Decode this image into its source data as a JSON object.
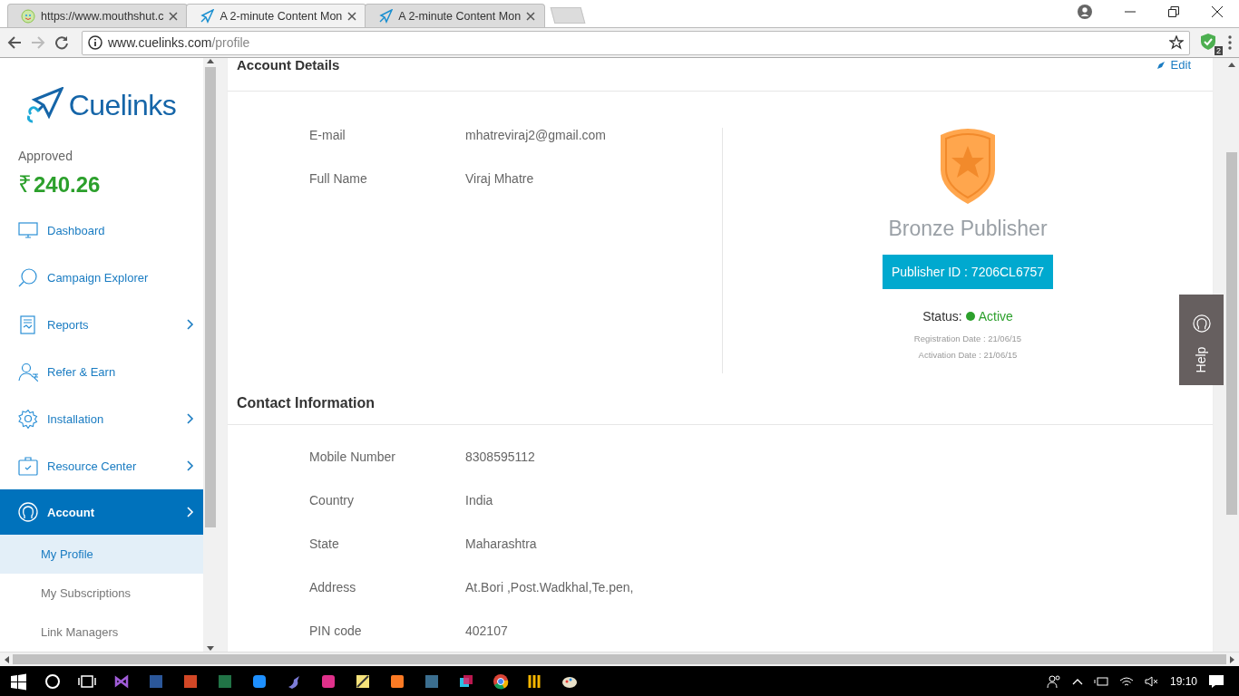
{
  "browser": {
    "tabs": [
      {
        "title": "https://www.mouthshut.c",
        "selected": false
      },
      {
        "title": "A 2-minute Content Mon",
        "selected": true
      },
      {
        "title": "A 2-minute Content Mon",
        "selected": false
      }
    ],
    "address": {
      "domain": "www.cuelinks.com",
      "path": "/profile"
    },
    "extension_badge": "2"
  },
  "sidebar": {
    "logo": "Cuelinks",
    "approved_label": "Approved",
    "currency": "₹",
    "amount": "240.26",
    "items": [
      {
        "label": "Dashboard",
        "expandable": false,
        "selected": false
      },
      {
        "label": "Campaign Explorer",
        "expandable": false,
        "selected": false
      },
      {
        "label": "Reports",
        "expandable": true,
        "selected": false
      },
      {
        "label": "Refer & Earn",
        "expandable": false,
        "selected": false
      },
      {
        "label": "Installation",
        "expandable": true,
        "selected": false
      },
      {
        "label": "Resource Center",
        "expandable": true,
        "selected": false
      },
      {
        "label": "Account",
        "expandable": true,
        "selected": true
      }
    ],
    "subitems": [
      {
        "label": "My Profile",
        "selected": true
      },
      {
        "label": "My Subscriptions",
        "selected": false
      },
      {
        "label": "Link Managers",
        "selected": false
      }
    ]
  },
  "account_details": {
    "title": "Account Details",
    "edit": "Edit",
    "fields": [
      {
        "label": "E-mail",
        "value": "mhatreviraj2@gmail.com"
      },
      {
        "label": "Full Name",
        "value": "Viraj Mhatre"
      }
    ]
  },
  "publisher": {
    "level": "Bronze Publisher",
    "publisher_id": "Publisher ID : 7206CL6757",
    "status_label": "Status:",
    "status": "Active",
    "registration": "Registration Date : 21/06/15",
    "activation": "Activation Date : 21/06/15"
  },
  "contact_information": {
    "title": "Contact Information",
    "fields": [
      {
        "label": "Mobile Number",
        "value": "8308595112"
      },
      {
        "label": "Country",
        "value": "India"
      },
      {
        "label": "State",
        "value": "Maharashtra"
      },
      {
        "label": "Address",
        "value": "At.Bori ,Post.Wadkhal,Te.pen,"
      },
      {
        "label": "PIN code",
        "value": "402107"
      }
    ]
  },
  "help_tab": "Help",
  "taskbar": {
    "clock": "19:10"
  }
}
